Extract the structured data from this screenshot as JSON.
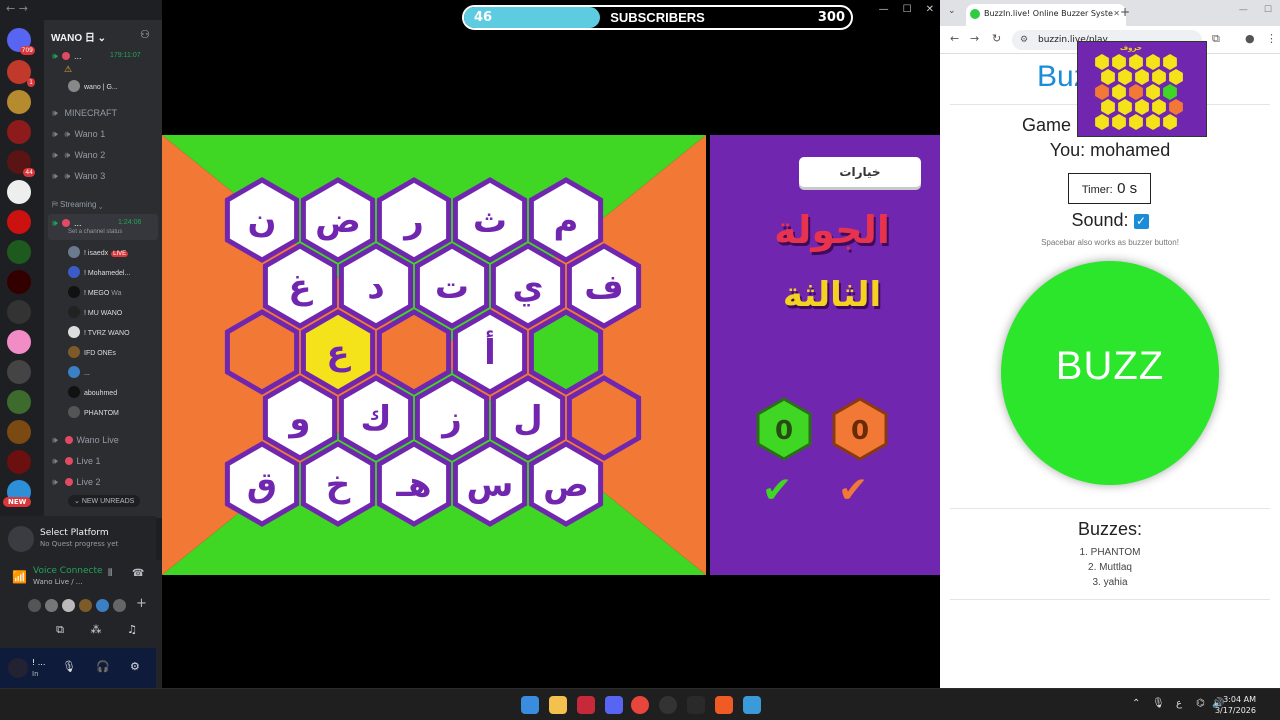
{
  "discord": {
    "server_name": "WANO 日",
    "guild_badges": [
      "709",
      "1",
      "44"
    ],
    "new_pill": "NEW",
    "channels": [
      {
        "name": "...",
        "type": "voice-active"
      },
      {
        "name": "MINECRAFT",
        "type": "voice"
      },
      {
        "name": "Wano 1",
        "type": "voice"
      },
      {
        "name": "Wano 2",
        "type": "voice"
      },
      {
        "name": "Wano 3",
        "type": "voice"
      }
    ],
    "top_timer": "179:11:07",
    "top_member": "wano | G...",
    "streaming_section": "Streaming",
    "streaming_channel": "...",
    "streaming_timer": "1:24:06",
    "channel_status": "Set a channel status",
    "members": [
      {
        "name": "! isaedx",
        "tag": "LIVE"
      },
      {
        "name": "! Mohamedel...",
        "tag": ""
      },
      {
        "name": "! MEGO",
        "tag": "Wa"
      },
      {
        "name": "! MU",
        "tag": "WANO"
      },
      {
        "name": "! TVRZ",
        "tag": "WANO"
      },
      {
        "name": "IFD",
        "tag": "ONEs"
      },
      {
        "name": "...",
        "tag": ""
      },
      {
        "name": "abouhmed",
        "tag": ""
      },
      {
        "name": "PHANTOM",
        "tag": ""
      }
    ],
    "live_channels": [
      "Wano Live",
      "Live 1",
      "Live 2"
    ],
    "new_unreads": "NEW UNREADS",
    "quest_title": "Select Platform",
    "quest_sub": "No Quest progress yet",
    "voice_title": "Voice Connecte",
    "voice_sub": "Wano Live / ...",
    "user_name": "! ...",
    "user_status": "In"
  },
  "stream": {
    "subs_current": "46",
    "subs_label": "SUBSCRIBERS",
    "subs_goal": "300",
    "subs_progress": 0.153,
    "options_button": "خيارات",
    "round_line1": "الجولة",
    "round_line2": "الثالثة",
    "score_green": "0",
    "score_orange": "0",
    "colors": {
      "green": "#3fd624",
      "orange": "#f27935",
      "purple": "#7026ae",
      "yellow": "#f4e21b"
    },
    "hex_rows": [
      [
        "ن",
        "ض",
        "ر",
        "ث",
        "م"
      ],
      [
        "غ",
        "د",
        "ت",
        "ي",
        "ف"
      ],
      [
        "",
        "ع",
        "",
        "أ",
        ""
      ],
      [
        "و",
        "ك",
        "ز",
        "ل",
        ""
      ],
      [
        "ق",
        "خ",
        "هـ",
        "س",
        "ص"
      ]
    ],
    "hex_states": [
      [
        "white",
        "white",
        "white",
        "white",
        "white"
      ],
      [
        "white",
        "white",
        "white",
        "white",
        "white"
      ],
      [
        "orange",
        "yellow",
        "orange",
        "white",
        "green"
      ],
      [
        "white",
        "white",
        "white",
        "white",
        "orange"
      ],
      [
        "white",
        "white",
        "white",
        "white",
        "white"
      ]
    ]
  },
  "browser": {
    "tab_title": "BuzzIn.live! Online Buzzer Syste",
    "url": "buzzin.live/play",
    "logo": "Buz",
    "game_label": "Game",
    "you_line": "You: mohamed",
    "timer_label": "Timer:",
    "timer_value": "0 s",
    "sound_label": "Sound:",
    "sound_checked": "✓",
    "hint": "Spacebar also works as buzzer button!",
    "buzz_label": "BUZZ",
    "buzzes_title": "Buzzes:",
    "buzzes": [
      "1. PHANTOM",
      "2. Muttlaq",
      "3. yahia"
    ],
    "thumb_title": "حروف"
  },
  "taskbar": {
    "time": "3:04 AM",
    "date": "3/17/2026",
    "lang": "ع"
  }
}
